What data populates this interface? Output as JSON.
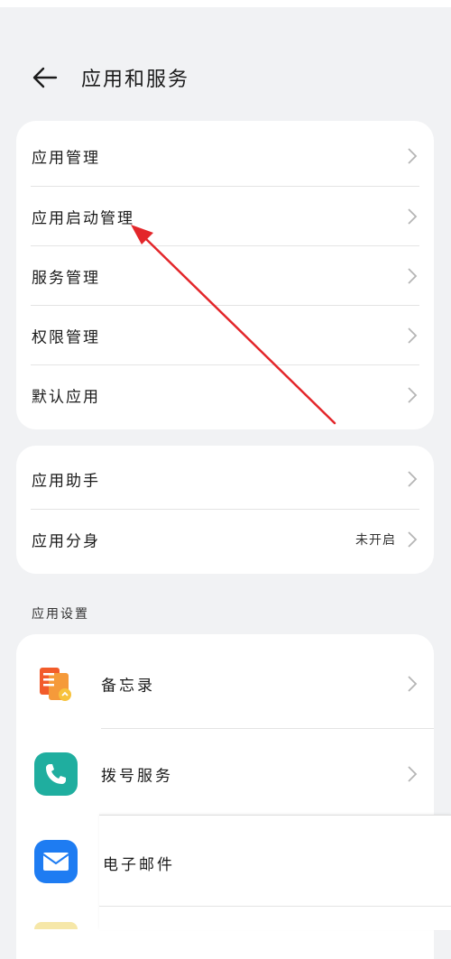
{
  "header": {
    "title": "应用和服务",
    "back_icon": "arrow-left-icon"
  },
  "group1": {
    "items": [
      {
        "label": "应用管理"
      },
      {
        "label": "应用启动管理"
      },
      {
        "label": "服务管理"
      },
      {
        "label": "权限管理"
      },
      {
        "label": "默认应用"
      }
    ]
  },
  "group2": {
    "items": [
      {
        "label": "应用助手"
      },
      {
        "label": "应用分身",
        "value": "未开启"
      }
    ]
  },
  "app_settings": {
    "section_title": "应用设置",
    "items": [
      {
        "label": "备忘录",
        "icon": "notes-app-icon"
      },
      {
        "label": "拨号服务",
        "icon": "dialer-app-icon"
      },
      {
        "label": "电子邮件",
        "icon": "email-app-icon"
      }
    ]
  },
  "colors": {
    "background": "#f1f2f4",
    "annotation_arrow": "#e3262a",
    "dialer_icon": "#1fae9f",
    "mail_icon": "#1e7cf2"
  }
}
